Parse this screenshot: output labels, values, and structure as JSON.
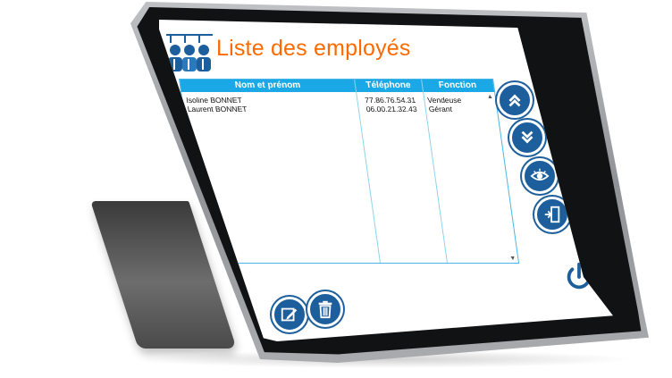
{
  "header": {
    "title": "Liste des employés"
  },
  "table": {
    "columns": [
      "Nom et prénom",
      "Téléphone",
      "Fonction"
    ],
    "rows": [
      {
        "name": "Isoline BONNET",
        "phone": "77.86.76.54.31",
        "role": "Vendeuse"
      },
      {
        "name": "Laurent BONNET",
        "phone": "06.00.21.32.43",
        "role": "Gérant"
      }
    ]
  },
  "icons": {
    "logo": "people-group-icon",
    "first": "double-chevron-up-icon",
    "last": "double-chevron-down-icon",
    "view": "eye-icon",
    "exit": "door-exit-icon",
    "power": "power-icon",
    "edit": "pencil-edit-icon",
    "delete": "trash-icon"
  },
  "colors": {
    "title": "#ff6a00",
    "header_bg": "#1aa9e6",
    "button_bg": "#1d5f9c"
  }
}
